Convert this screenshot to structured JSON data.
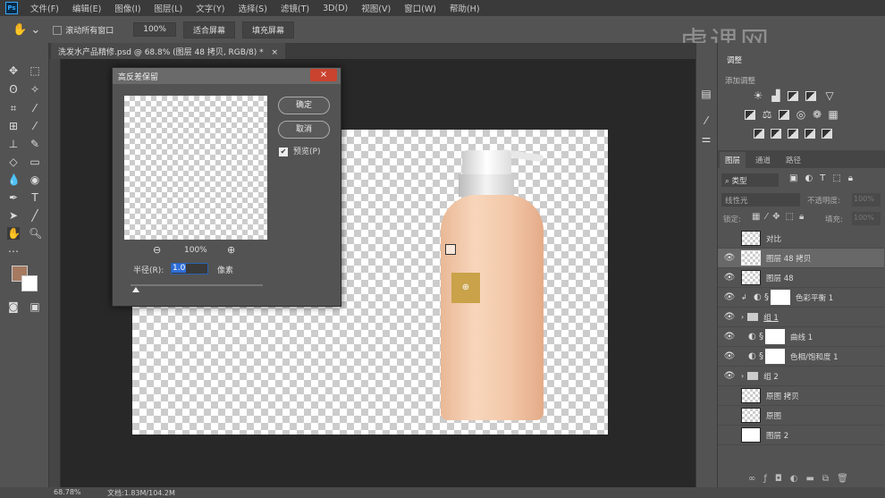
{
  "menubar": {
    "logo": "Ps",
    "items": [
      "文件(F)",
      "编辑(E)",
      "图像(I)",
      "图层(L)",
      "文字(Y)",
      "选择(S)",
      "滤镜(T)",
      "3D(D)",
      "视图(V)",
      "窗口(W)",
      "帮助(H)"
    ]
  },
  "options": {
    "scroll_all": "滚动所有窗口",
    "zoom100": "100%",
    "fit_screen": "适合屏幕",
    "fill_screen": "填充屏幕"
  },
  "document_tab": {
    "title": "洗发水产品精修.psd @ 68.8% (图层 48 拷贝, RGB/8) *",
    "close": "×"
  },
  "watermark": "虎课网",
  "dialog": {
    "title": "高反差保留",
    "close": "×",
    "ok": "确定",
    "cancel": "取消",
    "preview_label": "预览(P)",
    "preview_checked": true,
    "zoom": "100%",
    "radius_label": "半径(R):",
    "radius_value": "1.0",
    "radius_unit": "像素"
  },
  "panel": {
    "adjust_tab": "调整",
    "adjust_title": "添加调整",
    "tabs": [
      "图层",
      "通道",
      "路径"
    ],
    "filter_kind": "类型",
    "blend_mode": "线性光",
    "opacity_label": "不透明度:",
    "opacity": "100%",
    "lock_label": "锁定:",
    "fill_label": "填充:",
    "fill": "100%",
    "layers": [
      {
        "name": "对比",
        "visible": false,
        "kind": "pixel"
      },
      {
        "name": "图层 48 拷贝",
        "visible": true,
        "kind": "pixel",
        "selected": true
      },
      {
        "name": "图层 48",
        "visible": true,
        "kind": "pixel"
      },
      {
        "name": "色彩平衡 1",
        "visible": true,
        "kind": "adjust"
      },
      {
        "name": "组 1",
        "visible": true,
        "kind": "group"
      },
      {
        "name": "曲线 1",
        "visible": true,
        "kind": "adjust"
      },
      {
        "name": "色相/饱和度 1",
        "visible": true,
        "kind": "adjust"
      },
      {
        "name": "组 2",
        "visible": true,
        "kind": "group"
      },
      {
        "name": "原图 拷贝",
        "visible": false,
        "kind": "pixel"
      },
      {
        "name": "原图",
        "visible": false,
        "kind": "pixel"
      },
      {
        "name": "图层 2",
        "visible": false,
        "kind": "white"
      }
    ]
  },
  "status": {
    "zoom": "68.78%",
    "doc": "文档:1.83M/104.2M"
  }
}
